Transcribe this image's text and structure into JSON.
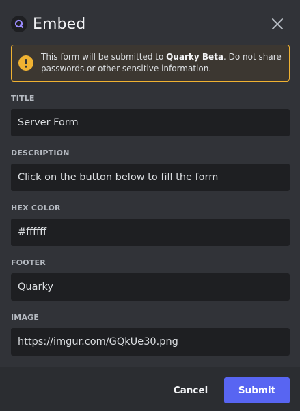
{
  "modal": {
    "title": "Embed",
    "app_icon": "quarky-q-icon",
    "close_icon": "close-icon"
  },
  "warning": {
    "icon": "exclamation-icon",
    "text_before": "This form will be submitted to ",
    "app_name": "Quarky Beta",
    "text_after": ". Do not share passwords or other sensitive information."
  },
  "fields": [
    {
      "label": "TITLE",
      "value": "Server Form"
    },
    {
      "label": "DESCRIPTION",
      "value": "Click on the button below to fill the form"
    },
    {
      "label": "HEX COLOR",
      "value": "#ffffff"
    },
    {
      "label": "FOOTER",
      "value": "Quarky"
    },
    {
      "label": "IMAGE",
      "value": "https://imgur.com/GQkUe30.png"
    }
  ],
  "actions": {
    "cancel_label": "Cancel",
    "submit_label": "Submit"
  },
  "colors": {
    "background": "#313338",
    "input_bg": "#1e1f22",
    "warning_border": "#f0b232",
    "accent": "#5865f2"
  }
}
